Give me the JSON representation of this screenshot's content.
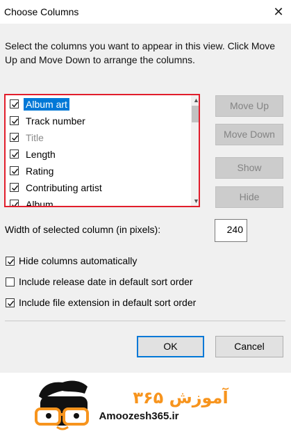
{
  "dialog": {
    "title": "Choose Columns",
    "close_glyph": "✕",
    "description": "Select the columns you want to appear in this view. Click Move Up and Move Down to arrange the columns."
  },
  "columns": [
    {
      "label": "Album art",
      "checked": true,
      "selected": true,
      "disabled": false
    },
    {
      "label": "Track number",
      "checked": true,
      "selected": false,
      "disabled": false
    },
    {
      "label": "Title",
      "checked": true,
      "selected": false,
      "disabled": true
    },
    {
      "label": "Length",
      "checked": true,
      "selected": false,
      "disabled": false
    },
    {
      "label": "Rating",
      "checked": true,
      "selected": false,
      "disabled": false
    },
    {
      "label": "Contributing artist",
      "checked": true,
      "selected": false,
      "disabled": false
    },
    {
      "label": "Album",
      "checked": true,
      "selected": false,
      "disabled": false
    }
  ],
  "buttons": {
    "move_up": "Move Up",
    "move_down": "Move Down",
    "show": "Show",
    "hide": "Hide",
    "ok": "OK",
    "cancel": "Cancel"
  },
  "width": {
    "label": "Width of selected column (in pixels):",
    "value": "240"
  },
  "options": [
    {
      "label": "Hide columns automatically",
      "checked": true
    },
    {
      "label": "Include release date in default sort order",
      "checked": false
    },
    {
      "label": "Include file extension in default sort order",
      "checked": true
    }
  ],
  "watermark": {
    "text": "Amoozesh365.ir",
    "persian_text": "آموزش ۳۶۵"
  },
  "colors": {
    "selection": "#0078d7",
    "highlight_border": "#e11d2b",
    "logo_orange": "#f7941d"
  }
}
